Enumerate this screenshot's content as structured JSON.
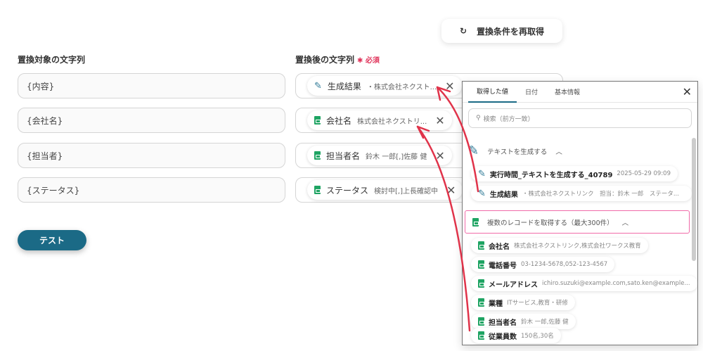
{
  "refresh_label": "置換条件を再取得",
  "left_label": "置換対象の文字列",
  "right_label": "置換後の文字列",
  "required": "必須",
  "targets": [
    "{内容}",
    "{会社名}",
    "{担当者}",
    "{ステータス}"
  ],
  "replacements": [
    {
      "name": "生成結果",
      "value": "・株式会社ネクスト...",
      "icon": "pen"
    },
    {
      "name": "会社名",
      "value": "株式会社ネクストリ...",
      "icon": "sheet"
    },
    {
      "name": "担当者名",
      "value": "鈴木 一郎[,]佐藤 健",
      "icon": "sheet"
    },
    {
      "name": "ステータス",
      "value": "検討中[,]上長確認中",
      "icon": "sheet"
    }
  ],
  "test_label": "テスト",
  "panel": {
    "tabs": [
      "取得した値",
      "日付",
      "基本情報"
    ],
    "search_placeholder": "検索（前方一致）",
    "section1": "テキストを生成する",
    "section1_items": [
      {
        "name": "実行時間_テキストを生成する_40789",
        "value": "2025-05-29 09:09"
      },
      {
        "name": "生成結果",
        "value": "・株式会社ネクストリンク　担当：鈴木 一郎　ステータ..."
      }
    ],
    "section2": "複数のレコードを取得する（最大300件）",
    "section2_items": [
      {
        "name": "会社名",
        "value": "株式会社ネクストリンク,株式会社ワークス教育"
      },
      {
        "name": "電話番号",
        "value": "03-1234-5678,052-123-4567"
      },
      {
        "name": "メールアドレス",
        "value": "ichiro.suzuki@example.com,sato.ken@example..."
      },
      {
        "name": "業種",
        "value": "ITサービス,教育・研修"
      },
      {
        "name": "担当者名",
        "value": "鈴木 一郎,佐藤 健"
      },
      {
        "name": "従業員数",
        "value": "150名,30名"
      }
    ]
  },
  "colors": {
    "accent": "#1b6a86",
    "arrow": "#e0334a",
    "highlight": "#f06aa8"
  }
}
